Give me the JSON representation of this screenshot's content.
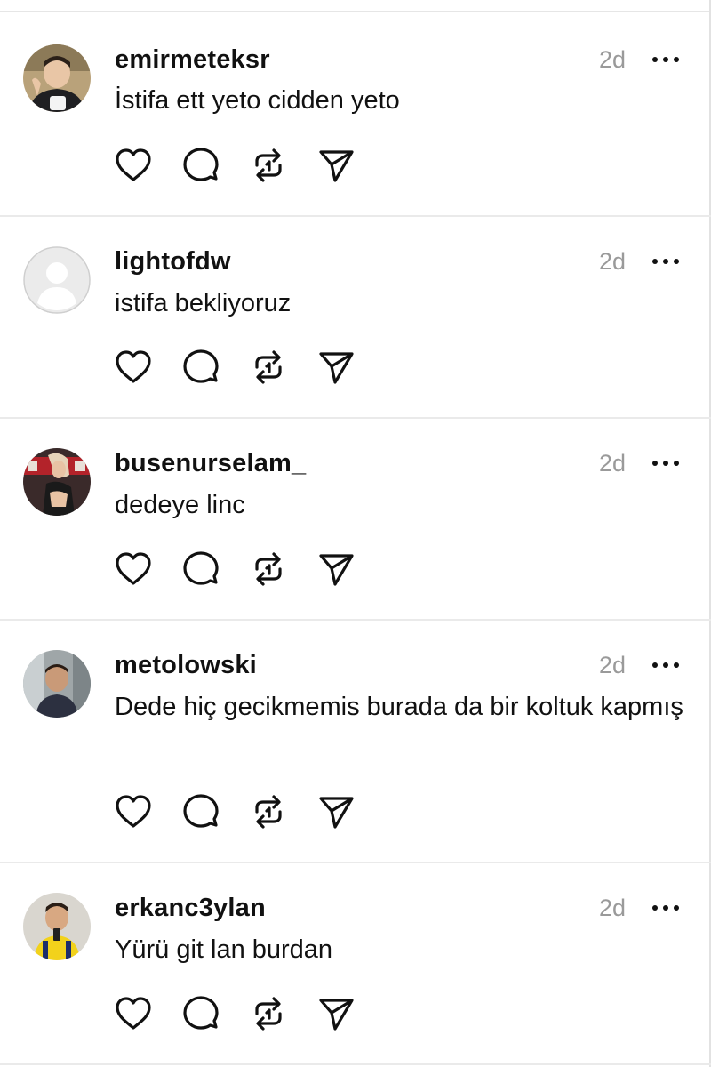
{
  "posts": [
    {
      "username": "emirmeteksr",
      "time": "2d",
      "text": "İstifa ett yeto cidden yeto",
      "avatar": "man-with-mug"
    },
    {
      "username": "lightofdw",
      "time": "2d",
      "text": "istifa bekliyoruz",
      "avatar": "default-avatar"
    },
    {
      "username": "busenurselam_",
      "time": "2d",
      "text": "dedeye linc",
      "avatar": "woman-photo"
    },
    {
      "username": "metolowski",
      "time": "2d",
      "text": "Dede hiç gecikmemis burada da bir koltuk kapmış",
      "avatar": "child-photo"
    },
    {
      "username": "erkanc3ylan",
      "time": "2d",
      "text": "Yürü git lan burdan",
      "avatar": "man-yellow-jersey"
    }
  ],
  "icons": {
    "more": "more-icon",
    "like": "heart-icon",
    "reply": "comment-icon",
    "repost": "repost-icon",
    "share": "send-icon"
  },
  "colors": {
    "text": "#111111",
    "muted": "#9a9a9a",
    "divider": "#eaeaea"
  }
}
